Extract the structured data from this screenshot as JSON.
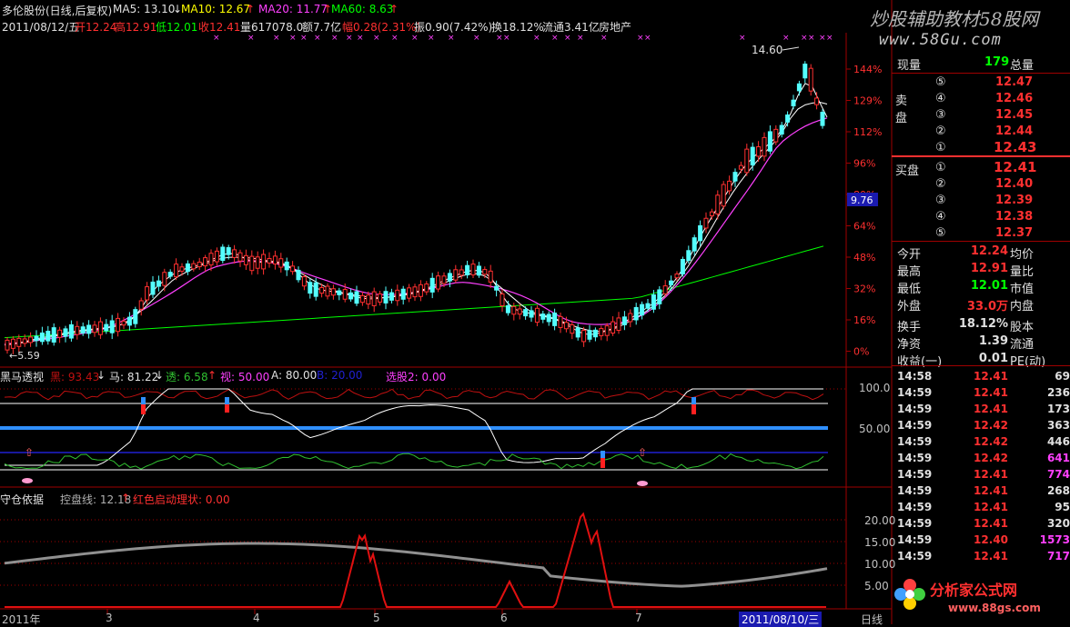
{
  "header": {
    "stock": "多伦股份(日线,后复权)",
    "ma5": "MA5: 13.10",
    "ma10": "MA10: 12.67",
    "ma20": "MA20: 11.77",
    "ma60": "MA60: 8.63",
    "date": "2011/08/12/五",
    "open": "开12.24",
    "high": "高12.91",
    "low": "低12.01",
    "close": "收12.41",
    "volume": "量617078.0",
    "amount": "额7.7亿",
    "change": "幅0.28(2.31%)",
    "amplitude": "振0.90(7.42%)",
    "turnover": "换18.12%",
    "float_cap": "流通3.41亿",
    "industry": "房地产"
  },
  "watermark": {
    "line1": "炒股辅助教材58股网",
    "line2": "www.58Gu.com",
    "bottom": "分析家公式网",
    "bottom_url": "www.88gs.com"
  },
  "price_chart": {
    "right_axis_labels": [
      "144%",
      "129%",
      "112%",
      "96%",
      "80%",
      "64%",
      "48%",
      "32%",
      "16%",
      "0%"
    ],
    "current_price_marker": "9.76",
    "high_label": "14.60",
    "low_label": "5.59"
  },
  "indicator1": {
    "name": "黑马透视",
    "hei": "黑: 93.43",
    "ma": "马: 81.22",
    "tou": "透: 6.58",
    "shi": "视: 50.00",
    "a": "A: 80.00",
    "b": "B: 20.00",
    "xuangu": "选股2: 0.00",
    "axis": [
      "100.0",
      "50.00"
    ]
  },
  "indicator2": {
    "name": "守仓依据",
    "kongpan": "控盘线: 12.18",
    "hongse": "红色启动理状: 0.00",
    "axis": [
      "20.00",
      "15.00",
      "10.00",
      "5.00"
    ]
  },
  "x_axis": {
    "labels": [
      "2011年",
      "3",
      "4",
      "5",
      "6",
      "7",
      "2011/08/10/三"
    ],
    "period": "日线"
  },
  "quote_panel": {
    "xianliang_label": "现量",
    "xianliang_value": "179",
    "zongliang_label": "总量",
    "sell_label": "卖盘",
    "buy_label": "买盘",
    "sell": [
      {
        "level": "⑤",
        "price": "12.47"
      },
      {
        "level": "④",
        "price": "12.46"
      },
      {
        "level": "③",
        "price": "12.45"
      },
      {
        "level": "②",
        "price": "12.44"
      },
      {
        "level": "①",
        "price": "12.43"
      }
    ],
    "buy": [
      {
        "level": "①",
        "price": "12.41"
      },
      {
        "level": "②",
        "price": "12.40"
      },
      {
        "level": "③",
        "price": "12.39"
      },
      {
        "level": "④",
        "price": "12.38"
      },
      {
        "level": "⑤",
        "price": "12.37"
      }
    ],
    "stats": [
      {
        "label": "今开",
        "value": "12.24",
        "label2": "均价"
      },
      {
        "label": "最高",
        "value": "12.91",
        "label2": "量比"
      },
      {
        "label": "最低",
        "value": "12.01",
        "label2": "市值"
      },
      {
        "label": "外盘",
        "value": "33.0万",
        "label2": "内盘"
      },
      {
        "label": "换手",
        "value": "18.12%",
        "label2": "股本"
      },
      {
        "label": "净资",
        "value": "1.39",
        "label2": "流通"
      },
      {
        "label": "收益(一)",
        "value": "0.01",
        "label2": "PE(动)"
      }
    ],
    "ticks": [
      {
        "time": "14:58",
        "price": "12.41",
        "vol": "69"
      },
      {
        "time": "14:59",
        "price": "12.41",
        "vol": "236"
      },
      {
        "time": "14:59",
        "price": "12.41",
        "vol": "173"
      },
      {
        "time": "14:59",
        "price": "12.42",
        "vol": "363"
      },
      {
        "time": "14:59",
        "price": "12.42",
        "vol": "446"
      },
      {
        "time": "14:59",
        "price": "12.42",
        "vol": "641"
      },
      {
        "time": "14:59",
        "price": "12.41",
        "vol": "774"
      },
      {
        "time": "14:59",
        "price": "12.41",
        "vol": "268"
      },
      {
        "time": "14:59",
        "price": "12.41",
        "vol": "95"
      },
      {
        "time": "14:59",
        "price": "12.41",
        "vol": "320"
      },
      {
        "time": "14:59",
        "price": "12.40",
        "vol": "1573"
      },
      {
        "time": "14:59",
        "price": "12.41",
        "vol": "717"
      }
    ]
  },
  "colors": {
    "up": "#ff3030",
    "down": "#54ffff",
    "ma5": "#ffffff",
    "ma10": "#ffff00",
    "ma20": "#ff40ff",
    "ma60": "#00ff00",
    "grid": "#a00000"
  }
}
